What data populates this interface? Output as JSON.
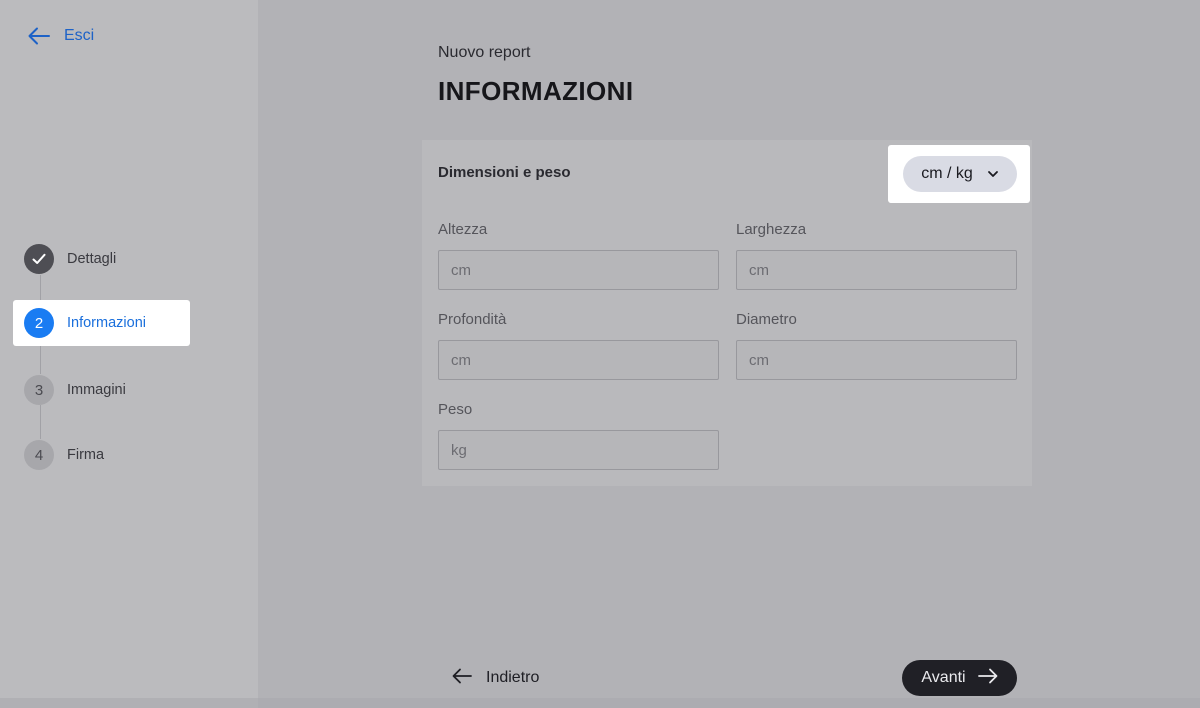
{
  "nav": {
    "exit_label": "Esci"
  },
  "steps": [
    {
      "number": "",
      "label": "Dettagli",
      "status": "done"
    },
    {
      "number": "2",
      "label": "Informazioni",
      "status": "active"
    },
    {
      "number": "3",
      "label": "Immagini",
      "status": "pending"
    },
    {
      "number": "4",
      "label": "Firma",
      "status": "pending"
    }
  ],
  "header": {
    "subtitle": "Nuovo report",
    "title": "INFORMAZIONI"
  },
  "section": {
    "title": "Dimensioni e peso",
    "unit_select": {
      "value": "cm / kg"
    }
  },
  "fields": {
    "altezza": {
      "label": "Altezza",
      "placeholder": "cm",
      "value": ""
    },
    "larghezza": {
      "label": "Larghezza",
      "placeholder": "cm",
      "value": ""
    },
    "profondita": {
      "label": "Profondità",
      "placeholder": "cm",
      "value": ""
    },
    "diametro": {
      "label": "Diametro",
      "placeholder": "cm",
      "value": ""
    },
    "peso": {
      "label": "Peso",
      "placeholder": "kg",
      "value": ""
    }
  },
  "footer": {
    "back_label": "Indietro",
    "next_label": "Avanti"
  },
  "colors": {
    "accent": "#1a7cf2",
    "primary_dark": "#202026",
    "link": "#1d62c7"
  }
}
